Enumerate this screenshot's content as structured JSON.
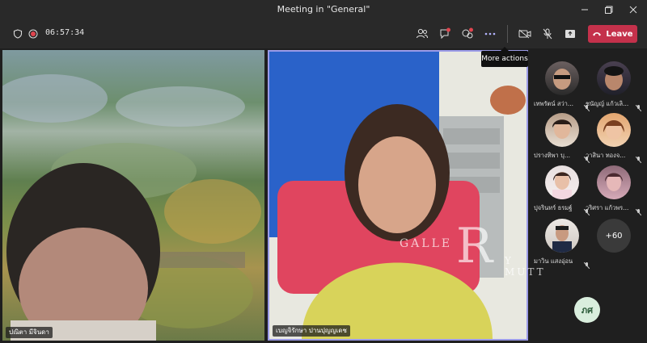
{
  "window": {
    "title": "Meeting in \"General\""
  },
  "toolbar": {
    "timer": "06:57:34",
    "leave_label": "Leave",
    "tooltip": "More actions",
    "icons": [
      "shield-icon",
      "record-icon",
      "people-icon",
      "chat-icon",
      "reactions-icon",
      "more-icon",
      "camera-icon",
      "mic-off-icon",
      "share-icon",
      "phone-icon"
    ]
  },
  "videos": [
    {
      "name": "ปณิตา มีจินดา"
    },
    {
      "name": "เบญจิรักษา ปานปุญญเดช"
    }
  ],
  "roster": {
    "participants": [
      {
        "name": "เทพรัตน์ สว่า..."
      },
      {
        "name": "ชนัญญ์ แก้วเลิ..."
      },
      {
        "name": "ปรางทิพา บุ..."
      },
      {
        "name": "วาสินา ทองจ..."
      },
      {
        "name": "ปุจรินทร์ ธรมฐ์"
      },
      {
        "name": "วริศรา แก้วพร..."
      },
      {
        "name": "มาวิน แสงอุ่อน"
      }
    ],
    "more_count": "+60",
    "self_initials": "ภศ"
  },
  "watermark": {
    "left": "GALLE",
    "big": "R",
    "right": "Y MUTT"
  },
  "colors": {
    "leave": "#c4314b",
    "accent_border": "#9b9be8",
    "titlebar": "#292929"
  }
}
